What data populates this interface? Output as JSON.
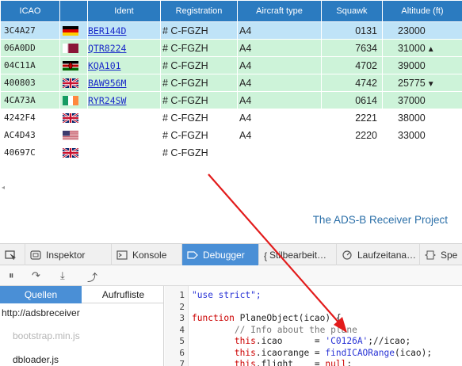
{
  "table": {
    "headers": [
      "ICAO",
      "",
      "Ident",
      "Registration",
      "Aircraft type",
      "Squawk",
      "Altitude (ft)"
    ],
    "rows": [
      {
        "icao": "3C4A27",
        "flag": "de",
        "ident": "BER144D",
        "reg": "# C-FGZH",
        "type": "A4",
        "squawk": "0131",
        "alt": "23000",
        "trend": "",
        "style": "sel"
      },
      {
        "icao": "06A0DD",
        "flag": "qa",
        "ident": "QTR8224",
        "reg": "# C-FGZH",
        "type": "A4",
        "squawk": "7634",
        "alt": "31000",
        "trend": "▲",
        "style": "green"
      },
      {
        "icao": "04C11A",
        "flag": "ke",
        "ident": "KQA101",
        "reg": "# C-FGZH",
        "type": "A4",
        "squawk": "4702",
        "alt": "39000",
        "trend": "",
        "style": "green"
      },
      {
        "icao": "400803",
        "flag": "gb",
        "ident": "BAW956M",
        "reg": "# C-FGZH",
        "type": "A4",
        "squawk": "4742",
        "alt": "25775",
        "trend": "▼",
        "style": "green"
      },
      {
        "icao": "4CA73A",
        "flag": "ie",
        "ident": "RYR24SW",
        "reg": "# C-FGZH",
        "type": "A4",
        "squawk": "0614",
        "alt": "37000",
        "trend": "",
        "style": "green"
      },
      {
        "icao": "4242F4",
        "flag": "gb",
        "ident": "",
        "reg": "# C-FGZH",
        "type": "A4",
        "squawk": "2221",
        "alt": "38000",
        "trend": "",
        "style": "plain"
      },
      {
        "icao": "AC4D43",
        "flag": "us",
        "ident": "",
        "reg": "# C-FGZH",
        "type": "A4",
        "squawk": "2220",
        "alt": "33000",
        "trend": "",
        "style": "plain"
      },
      {
        "icao": "40697C",
        "flag": "gb",
        "ident": "",
        "reg": "# C-FGZH",
        "type": "",
        "squawk": "",
        "alt": "",
        "trend": "",
        "style": "plain"
      }
    ]
  },
  "page": {
    "title": "The ADS-B Receiver Project"
  },
  "devtools": {
    "tabs": [
      {
        "label": "Inspektor",
        "icon": "inspector-icon"
      },
      {
        "label": "Konsole",
        "icon": "console-icon"
      },
      {
        "label": "Debugger",
        "icon": "debugger-icon"
      },
      {
        "label": "Stilbearbeit…",
        "icon": "style-editor-icon"
      },
      {
        "label": "Laufzeitana…",
        "icon": "performance-icon"
      },
      {
        "label": "Spe",
        "icon": "storage-icon"
      }
    ],
    "side_tabs": [
      "Quellen",
      "Aufrufliste"
    ],
    "sources": [
      {
        "label": "http://adsbreceiver",
        "dim": false
      },
      {
        "label": "bootstrap.min.js",
        "dim": true
      },
      {
        "label": "dbloader.js",
        "dim": false
      }
    ],
    "code": {
      "line_numbers": [
        "1",
        "2",
        "3",
        "4",
        "5",
        "6",
        "7"
      ],
      "lines": [
        "\"use strict\";",
        "",
        "function PlaneObject(icao) {",
        "        // Info about the plane",
        "        this.icao      = 'C0126A';//icao;",
        "        this.icaorange = findICAORange(icao);",
        "        this.flight    = null;"
      ]
    }
  },
  "colors": {
    "header_blue": "#2b7bc0",
    "selected_row": "#bfe3f7",
    "green_row": "#cdf3d9",
    "link": "#1a29c9",
    "active_tab": "#4a8fd6",
    "arrow": "#e21b1b"
  }
}
